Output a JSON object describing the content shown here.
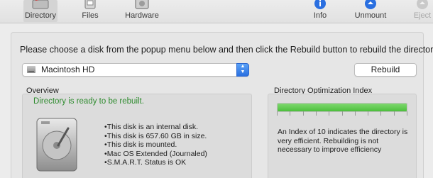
{
  "toolbar": {
    "items": [
      {
        "label": "Directory",
        "icon": "disk-utility-directory-icon",
        "selected": true
      },
      {
        "label": "Files",
        "icon": "files-icon"
      },
      {
        "label": "Hardware",
        "icon": "hardware-icon"
      },
      {
        "label": "Info",
        "icon": "info-icon"
      },
      {
        "label": "Unmount",
        "icon": "unmount-icon"
      },
      {
        "label": "Eject",
        "icon": "eject-icon",
        "disabled": true
      }
    ]
  },
  "main": {
    "instruction": "Please choose a disk from the popup menu below and then click the Rebuild button to rebuild the directory.",
    "disk_popup": {
      "selected": "Macintosh HD"
    },
    "rebuild_label": "Rebuild"
  },
  "overview": {
    "title": "Overview",
    "status": "Directory is ready to be rebuilt.",
    "facts": [
      "This disk is an internal disk.",
      "This disk is 657.60 GB in size.",
      "This disk is mounted.",
      "Mac OS Extended (Journaled)",
      "S.M.A.R.T. Status is OK"
    ]
  },
  "index": {
    "title": "Directory Optimization Index",
    "value": 10,
    "max": 10,
    "note": "An Index of 10 indicates the directory is very efficient. Rebuilding is not necessary to improve efficiency"
  },
  "colors": {
    "accent": "#2a6fe0",
    "ok_green": "#2e8b2e",
    "meter_green": "#4cbf3c"
  }
}
